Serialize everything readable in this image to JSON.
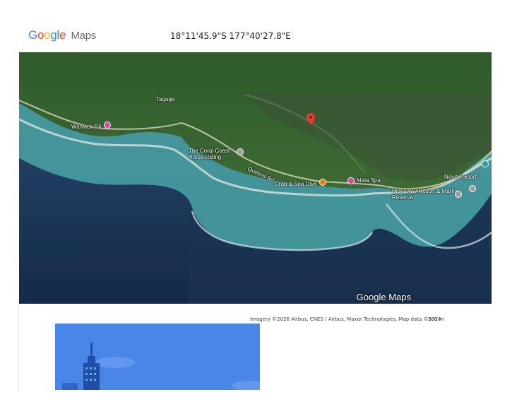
{
  "header": {
    "logo_google": "Google",
    "logo_maps": "Maps",
    "coordinates": "18°11'45.9\"S 177°40'27.8\"E"
  },
  "map": {
    "watermark": "Google Maps",
    "attribution": "Imagery ©2026 Airbus, CNES / Airbus, Maxar Technologies, Map data ©2026",
    "scale_label": "500 m",
    "places": [
      {
        "label": "Warwick Fiji",
        "pin_color": "#e040a0"
      },
      {
        "label": "Tagaqe",
        "pin_color": ""
      },
      {
        "label": "The Coral Coast Horse Riding",
        "pin_color": "#e0e0e0"
      },
      {
        "label": "Queens Rd",
        "pin_color": ""
      },
      {
        "label": "Crab & Sea Dive",
        "pin_color": "#f57c00"
      },
      {
        "label": "Mala Spa",
        "pin_color": "#e040a0"
      },
      {
        "label": "Naviti Resort",
        "pin_color": "#26a69a"
      },
      {
        "label": "Hideaway Resort & Marine Reserve",
        "pin_color": "#e0e0e0"
      }
    ],
    "selected_pin_color": "#e53935"
  },
  "colors": {
    "google_blue": "#4285f4",
    "google_red": "#ea4335",
    "google_yellow": "#fbbc05",
    "google_green": "#34a853",
    "promo_blue": "#4a86e8"
  }
}
